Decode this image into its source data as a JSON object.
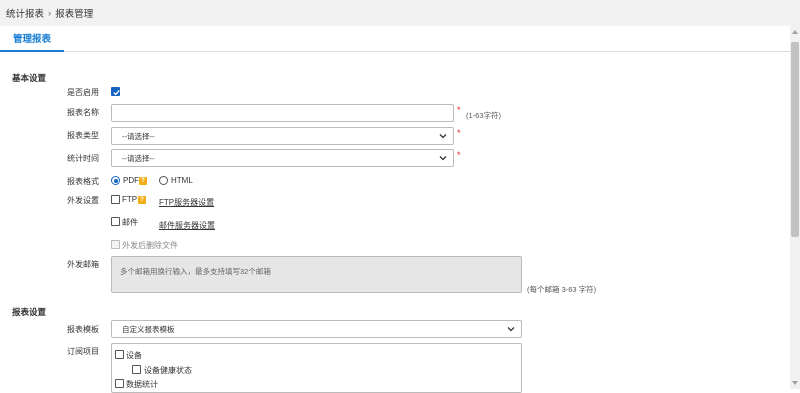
{
  "breadcrumb": {
    "parent": "统计报表",
    "separator": "›",
    "current": "报表管理"
  },
  "tabs": [
    {
      "label": "管理报表"
    }
  ],
  "basic": {
    "section_title": "基本设置",
    "enabled_label": "是否启用",
    "enabled": true,
    "name_label": "报表名称",
    "name_value": "",
    "name_hint": "(1-63字符)",
    "required_mark": "*",
    "type_label": "报表类型",
    "type_value": "--请选择--",
    "time_label": "统计时间",
    "time_value": "--请选择--",
    "format_label": "报表格式",
    "format_options": [
      "PDF",
      "HTML"
    ],
    "format_selected": "PDF",
    "help_glyph": "?",
    "send_label": "外发设置",
    "ftp_label": "FTP",
    "ftp_link": "FTP服务器设置",
    "mail_label": "邮件",
    "mail_link": "邮件服务器设置",
    "delete_after_label": "外发后删除文件",
    "email_label": "外发邮箱",
    "email_placeholder": "多个邮箱用换行输入，最多支持填写32个邮箱",
    "email_hint": "(每个邮箱 3-63 字符)"
  },
  "report": {
    "section_title": "报表设置",
    "template_label": "报表模板",
    "template_value": "自定义报表模板",
    "subscribe_label": "订阅项目",
    "items": [
      {
        "label": "设备",
        "checked": false
      },
      {
        "label": "设备健康状态",
        "checked": false
      },
      {
        "label": "数据统计",
        "checked": false
      }
    ]
  },
  "colors": {
    "accent": "#1a7fd4",
    "required": "#e02020",
    "help": "#f3b01b",
    "checkbox": "#1565c0"
  }
}
